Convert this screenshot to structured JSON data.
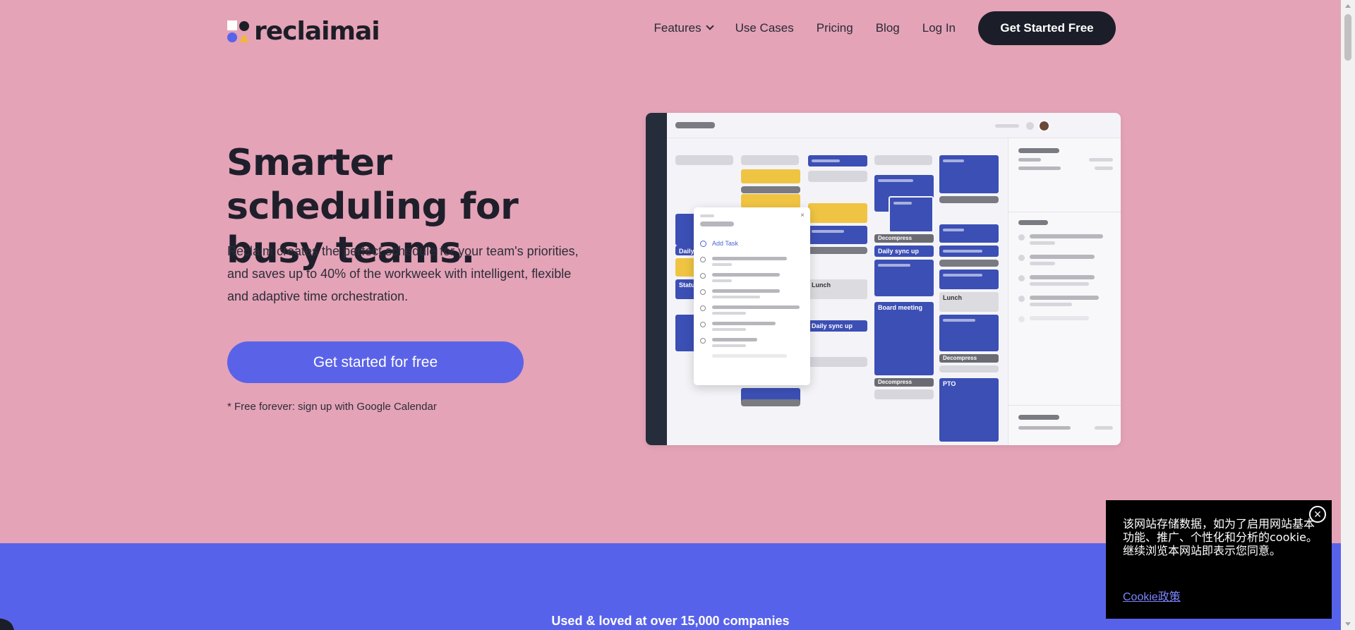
{
  "brand": {
    "name": "reclaimai"
  },
  "nav": {
    "items": [
      {
        "label": "Features"
      },
      {
        "label": "Use Cases"
      },
      {
        "label": "Pricing"
      },
      {
        "label": "Blog"
      },
      {
        "label": "Log In"
      }
    ],
    "cta": "Get Started Free"
  },
  "hero": {
    "title": "Smarter scheduling for busy teams.",
    "subtitle": "Reclaim creates the perfect schedule for your team's priorities, and saves up to 40% of the workweek with intelligent, flexible and adaptive time orchestration.",
    "button": "Get started for free",
    "note": "* Free forever: sign up with Google Calendar"
  },
  "mockup": {
    "events": {
      "daily1": "Daily",
      "status": "Statu",
      "lunch1": "Lunch",
      "daily_sync1": "Daily sync up",
      "decompress1": "Decompress",
      "daily_sync2": "Daily sync up",
      "board": "Board meeting",
      "decompress2": "Decompress",
      "lunch2": "Lunch",
      "decompress3": "Decompress",
      "pto": "PTO"
    },
    "popup": {
      "add_task": "Add Task",
      "close": "×"
    }
  },
  "band": {
    "text": "Used & loved at over 15,000 companies"
  },
  "cookie": {
    "text": "该网站存储数据，如为了启用网站基本功能、推广、个性化和分析的cookie。继续浏览本网站即表示您同意。",
    "link": "Cookie政策",
    "close": "×"
  },
  "colors": {
    "background": "#e4a3b7",
    "accent": "#5a63e8",
    "dark": "#1b1e28",
    "band": "#5762eb"
  }
}
